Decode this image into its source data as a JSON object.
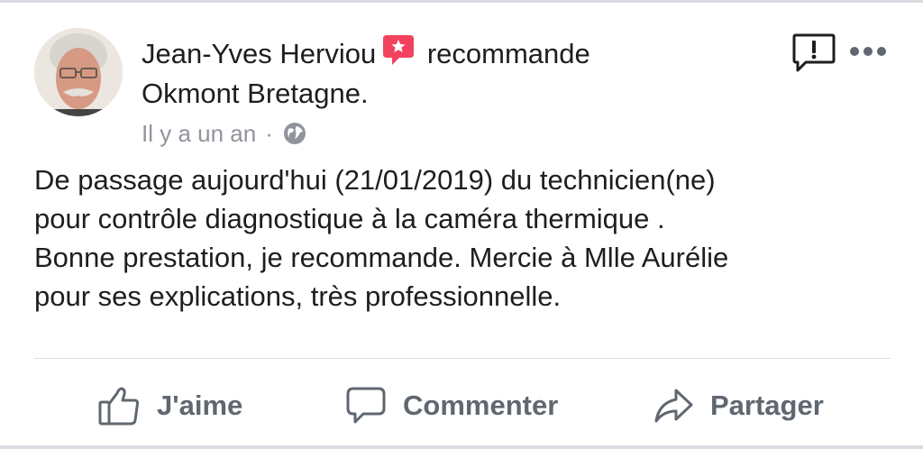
{
  "post": {
    "author": "Jean-Yves Herviou",
    "verb": "recommande",
    "page": "Okmont Bretagne.",
    "time": "Il y a un an",
    "separator": "·",
    "body": "De passage aujourd'hui (21/01/2019) du technicien(ne)\npour contrôle diagnostique à la caméra thermique .\nBonne prestation, je recommande. Mercie à Mlle Aurélie\npour ses explications, très professionnelle."
  },
  "actions": {
    "like": "J'aime",
    "comment": "Commenter",
    "share": "Partager"
  },
  "icons": {
    "recommend": "recommend-star-icon",
    "privacy": "globe-icon",
    "report": "report-icon",
    "more": "more-icon",
    "like": "thumbs-up-icon",
    "comment": "comment-icon",
    "share": "share-arrow-icon"
  },
  "colors": {
    "recommend_badge": "#f3425f",
    "muted": "#90949c",
    "action_text": "#606770",
    "text": "#1c1e21"
  }
}
